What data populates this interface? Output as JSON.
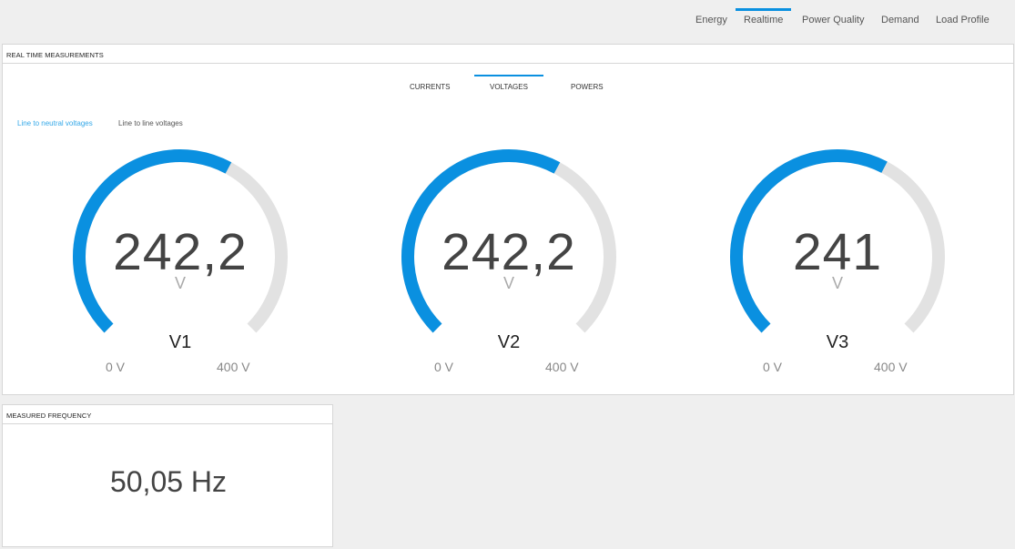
{
  "nav": {
    "items": [
      "Energy",
      "Realtime",
      "Power Quality",
      "Demand",
      "Load Profile"
    ],
    "active": "Realtime"
  },
  "realtime_panel": {
    "title": "REAL TIME MEASUREMENTS",
    "tabs": [
      "CURRENTS",
      "VOLTAGES",
      "POWERS"
    ],
    "active_tab": "VOLTAGES",
    "modes": [
      "Line to neutral voltages",
      "Line to line voltages"
    ],
    "active_mode": "Line to neutral voltages",
    "gauges": [
      {
        "value_text": "242,2",
        "value": 242.2,
        "unit": "V",
        "label": "V1",
        "min_text": "0 V",
        "max_text": "400 V",
        "min": 0,
        "max": 400
      },
      {
        "value_text": "242,2",
        "value": 242.2,
        "unit": "V",
        "label": "V2",
        "min_text": "0 V",
        "max_text": "400 V",
        "min": 0,
        "max": 400
      },
      {
        "value_text": "241",
        "value": 241,
        "unit": "V",
        "label": "V3",
        "min_text": "0 V",
        "max_text": "400 V",
        "min": 0,
        "max": 400
      }
    ]
  },
  "frequency_panel": {
    "title": "MEASURED FREQUENCY",
    "value": "50,05 Hz"
  },
  "colors": {
    "accent": "#0a90e0",
    "gauge_track": "#e2e2e2"
  }
}
